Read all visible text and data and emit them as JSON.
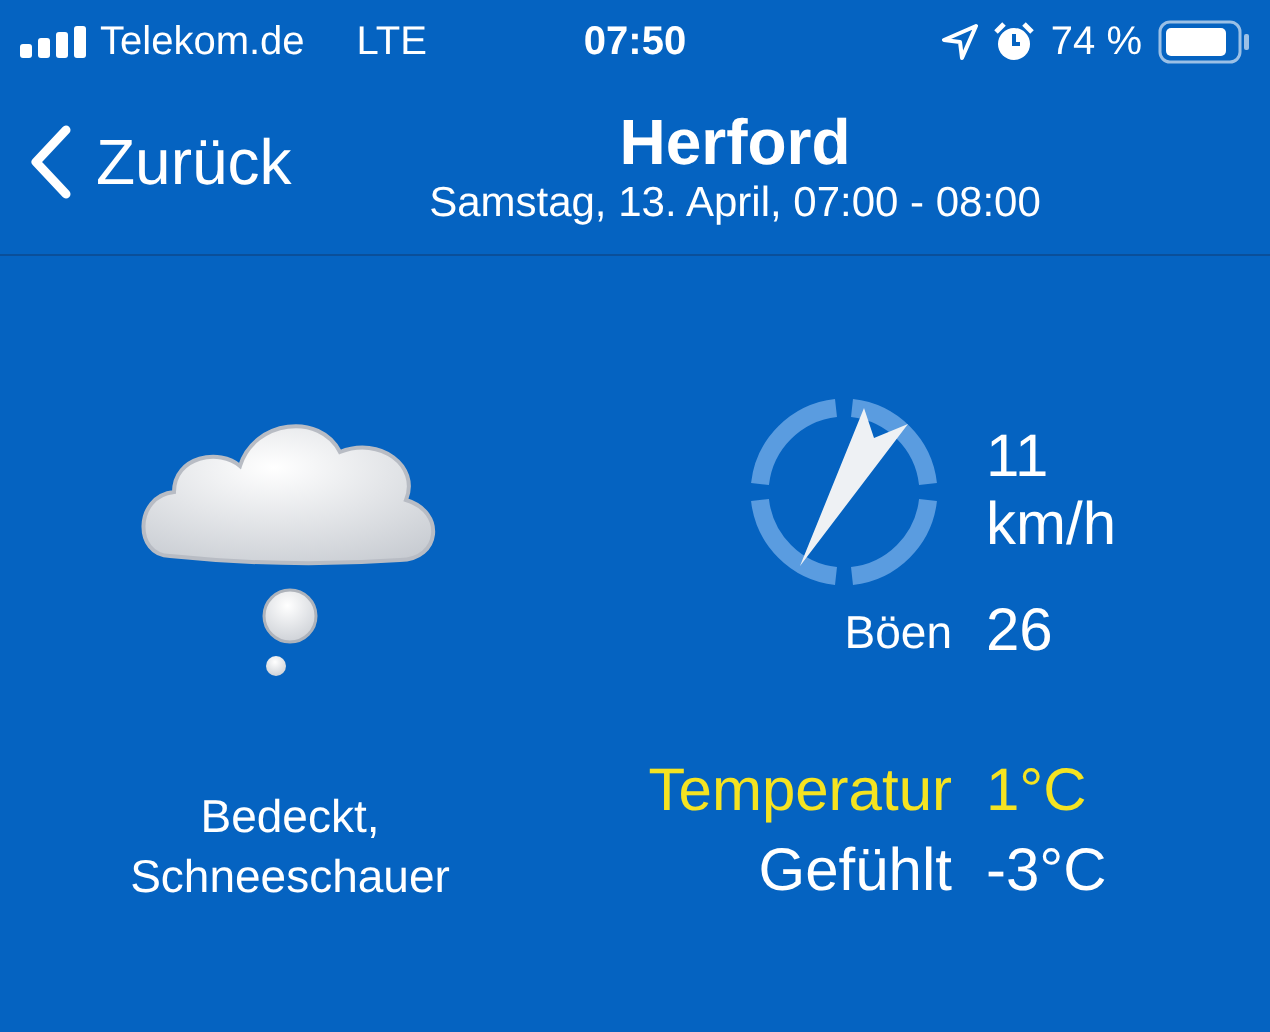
{
  "status_bar": {
    "carrier": "Telekom.de",
    "network": "LTE",
    "time": "07:50",
    "battery": "74 %"
  },
  "nav": {
    "back": "Zurück",
    "title": "Herford",
    "subtitle": "Samstag, 13. April, 07:00 - 08:00"
  },
  "condition": "Bedeckt, Schneeschauer",
  "wind": {
    "speed": "11",
    "unit": "km/h",
    "gusts_label": "Böen",
    "gusts": "26"
  },
  "readings": [
    {
      "label": "Temperatur",
      "value": "1°C",
      "highlighted": true
    },
    {
      "label": "Gefühlt",
      "value": "-3°C",
      "highlighted": false
    }
  ]
}
